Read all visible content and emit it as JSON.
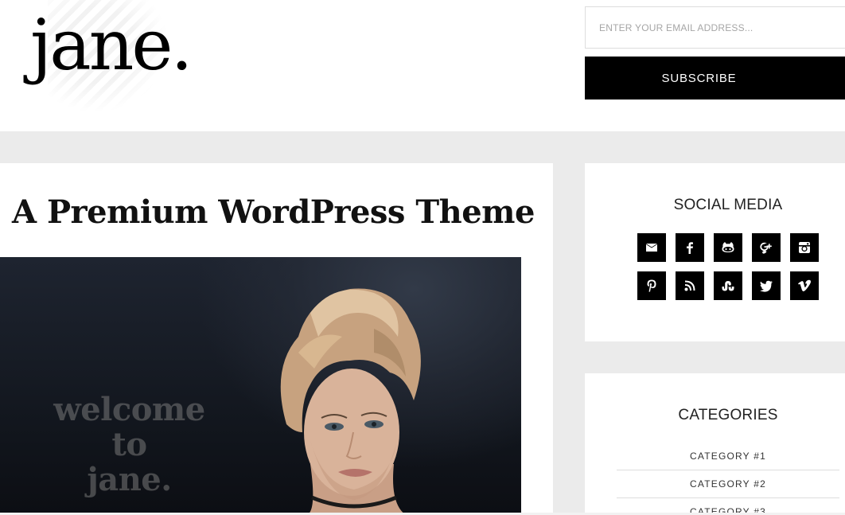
{
  "site": {
    "logo": "jane."
  },
  "subscribe": {
    "email_placeholder": "ENTER YOUR EMAIL ADDRESS...",
    "button_label": "SUBSCRIBE"
  },
  "post": {
    "title": "A Premium WordPress Theme",
    "hero_text_line1": "welcome to",
    "hero_text_line2": "jane."
  },
  "sidebar": {
    "social": {
      "title": "SOCIAL MEDIA",
      "icons": [
        "email-icon",
        "facebook-icon",
        "github-icon",
        "google-plus-icon",
        "instagram-icon",
        "pinterest-icon",
        "rss-icon",
        "stumbleupon-icon",
        "twitter-icon",
        "vimeo-icon"
      ]
    },
    "categories": {
      "title": "CATEGORIES",
      "items": [
        {
          "label": "CATEGORY #1"
        },
        {
          "label": "CATEGORY #2"
        },
        {
          "label": "CATEGORY #3"
        }
      ]
    }
  },
  "colors": {
    "accent": "#000000",
    "page_background": "#ebebeb",
    "card_background": "#ffffff"
  }
}
